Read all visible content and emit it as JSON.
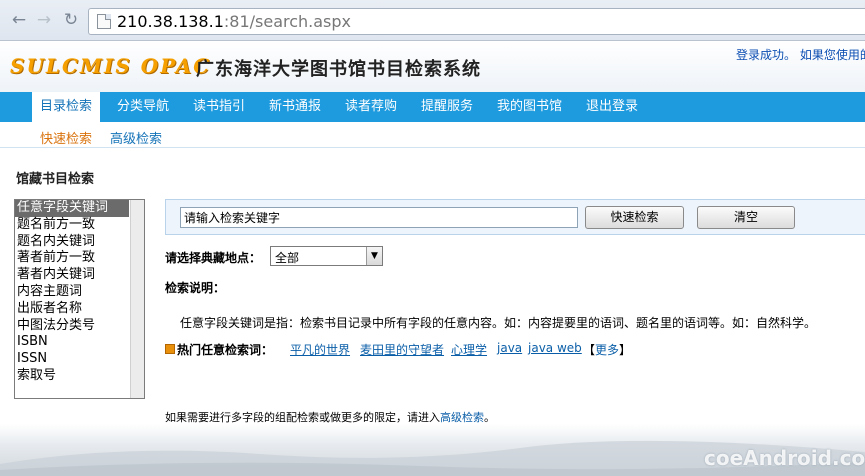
{
  "browser": {
    "url_host": "210.38.138.1",
    "url_rest": ":81/search.aspx"
  },
  "header": {
    "logo_text": "SULCMIS OPAC",
    "system_title": "广东海洋大学图书馆书目检索系统",
    "login_msg": "登录成功。  如果您使用的"
  },
  "main_nav": [
    "目录检索",
    "分类导航",
    "读书指引",
    "新书通报",
    "读者荐购",
    "提醒服务",
    "我的图书馆",
    "退出登录"
  ],
  "sub_nav": [
    "快速检索",
    "高级检索"
  ],
  "section_title": "馆藏书目检索",
  "search_fields": [
    "任意字段关键词",
    "题名前方一致",
    "题名内关键词",
    "著者前方一致",
    "著者内关键词",
    "内容主题词",
    "出版者名称",
    "中图法分类号",
    "ISBN",
    "ISSN",
    "索取号"
  ],
  "search": {
    "input_value": "请输入检索关键字",
    "quick_button": "快速检索",
    "clear_button": "清空"
  },
  "location": {
    "label": "请选择典藏地点：",
    "selected": "全部"
  },
  "help": {
    "label": "检索说明：",
    "text": "任意字段关键词是指：检索书目记录中所有字段的任意内容。如：内容提要里的语词、题名里的语词等。如：自然科学。"
  },
  "hot": {
    "label": "热门任意检索词：",
    "terms": [
      "平凡的世界",
      "麦田里的守望者",
      "心理学",
      "java",
      "java web"
    ],
    "more_open": "【",
    "more_link": "更多",
    "more_close": "】"
  },
  "bottom_note": {
    "prefix": "如果需要进行多字段的组配检索或做更多的限定，请进入",
    "link": "高级检索",
    "suffix": "。"
  },
  "watermark": "coeAndroid.com",
  "colors": {
    "nav_blue": "#1e9ade",
    "link_blue": "#0a5ea8",
    "logo_orange": "#f5a000",
    "sub_active": "#d9730d"
  }
}
